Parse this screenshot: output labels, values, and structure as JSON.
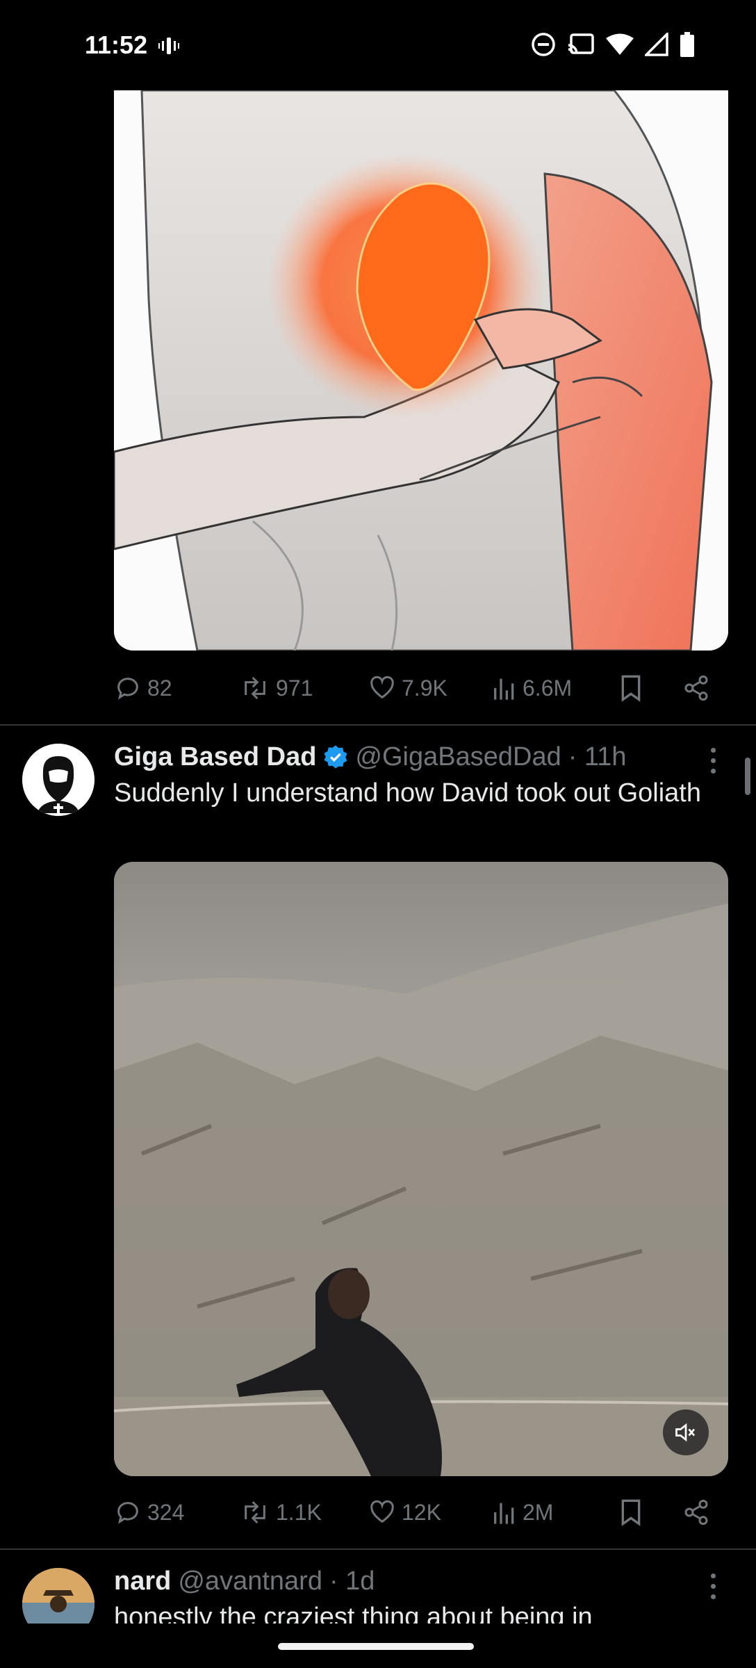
{
  "status_bar": {
    "time": "11:52",
    "icons": [
      "vibrate-icon",
      "dnd-icon",
      "cast-icon",
      "wifi-icon",
      "signal-icon",
      "battery-icon"
    ]
  },
  "tweet1": {
    "actions": {
      "replies": "82",
      "retweets": "971",
      "likes": "7.9K",
      "views": "6.6M"
    }
  },
  "tweet2": {
    "name": "Giga Based Dad",
    "handle": "@GigaBasedDad",
    "time": "· 11h",
    "text": "Suddenly I understand how David took out Goliath",
    "actions": {
      "replies": "324",
      "retweets": "1.1K",
      "likes": "12K",
      "views": "2M"
    }
  },
  "tweet3": {
    "name": "nard",
    "handle": "@avantnard",
    "time": "· 1d",
    "text": "honestly the craziest thing about being in"
  },
  "colors": {
    "background": "#000000",
    "text": "#e7e9ea",
    "muted": "#71767b",
    "verified": "#1d9bf0",
    "divider": "#2f3336"
  }
}
